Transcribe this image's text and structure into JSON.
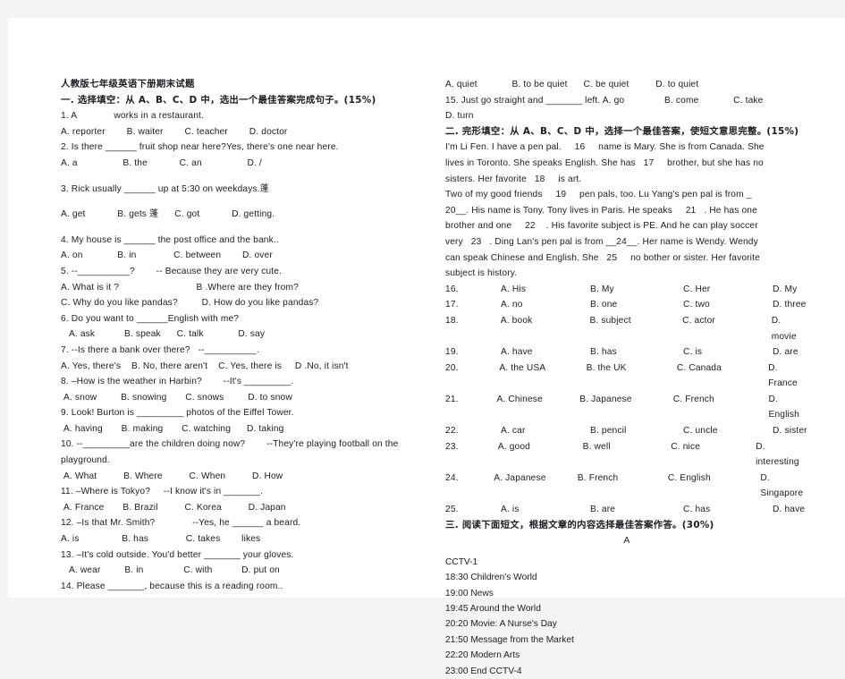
{
  "document": {
    "title": "人教版七年级英语下册期末试题"
  },
  "section_one": {
    "heading": "一. 选择填空：从 A、B、C、D 中，选出一个最佳答案完成句子。(15%)",
    "questions": [
      {
        "stem": "1. A              works in a restaurant.",
        "options": "A. reporter        B. waiter        C. teacher        D. doctor"
      },
      {
        "stem": "2. Is there ______ fruit shop near here?Yes, there's one near here.",
        "options": "A. a                 B. the            C. an                 D. /"
      },
      {
        "stem": "3. Rick usually ______ up at 5:30 on weekdays.蓬",
        "options": "A. get            B. gets 蓬      C. got            D. getting."
      },
      {
        "stem": "4. My house is ______ the post office and the bank..",
        "options": "A. on             B. in              C. between        D. over"
      },
      {
        "stem": "5. --__________?        -- Because they are very cute.",
        "options": "A. What is it ?                             B .Where are they from?",
        "options2": "C. Why do you like pandas?         D. How do you like pandas?"
      },
      {
        "stem": "6. Do you want to ______English with me?",
        "options": "   A. ask           B. speak      C. talk             D. say"
      },
      {
        "stem": "7. --Is there a bank over there?   --__________.",
        "options": "A. Yes, there's    B. No, there aren't    C. Yes, there is     D .No, it isn't"
      },
      {
        "stem": "8. –How is the weather in Harbin?        --It's _________.",
        "options": " A. snow         B. snowing       C. snows         D. to snow"
      },
      {
        "stem": "9. Look! Burton is _________ photos of the Eiffel Tower.",
        "options": " A. having       B. making       C. watching      D. taking"
      },
      {
        "stem": "10. --_________are the children doing now?        --They're playing football on the",
        "stem2": "playground.",
        "options": " A. What          B. Where          C. When          D. How"
      },
      {
        "stem": "11. –Where is Tokyo?     --I know it's in _______.",
        "options": " A. France       B. Brazil          C. Korea          D. Japan"
      },
      {
        "stem": "12. –Is that Mr. Smith?              --Yes, he ______ a beard.",
        "options": "A. is                B. has              C. takes        likes"
      },
      {
        "stem": "13. –It's cold outside. You'd better _______ your gloves.",
        "options": "   A. wear         B. in               C. with           D. put on"
      },
      {
        "stem": "14. Please _______, because this is a reading room..",
        "options": "A. quiet             B. to be quiet      C. be quiet          D. to quiet"
      },
      {
        "stem": "15. Just go straight and _______ left. A. go               B. come             C. take",
        "options": "D. turn"
      }
    ]
  },
  "section_two": {
    "heading": "二. 完形填空：从 A、B、C、D 中，选择一个最佳答案，使短文意思完整。(15%)",
    "passage": [
      "I'm Li Fen. I have a pen pal.     16     name is Mary. She is from Canada. She",
      "lives in Toronto. She speaks English. She has   17     brother, but she has no",
      "sisters. Her favorite   18     is art.",
      "Two of my good friends     19     pen pals, too. Lu Yang's pen pal is from _",
      "20__. His name is Tony. Tony lives in Paris. He speaks     21   . He has one",
      "brother and one     22    . His favorite subject is PE. And he can play soccer",
      "very   23   . Ding Lan's pen pal is from __24__. Her name is Wendy. Wendy",
      "can speak Chinese and English. She   25     no bother or sister. Her favorite",
      "subject is history."
    ],
    "options": [
      {
        "num": "16.",
        "a": "A. His",
        "b": "B. My",
        "c": "C. Her",
        "d": "D. My"
      },
      {
        "num": "17.",
        "a": "A. no",
        "b": "B. one",
        "c": "C. two",
        "d": "D. three"
      },
      {
        "num": "18.",
        "a": "A. book",
        "b": "B. subject",
        "c": "C. actor",
        "d": "D. movie"
      },
      {
        "num": "19.",
        "a": "A. have",
        "b": "B. has",
        "c": "C. is",
        "d": "D. are"
      },
      {
        "num": "20.",
        "a": "A. the USA",
        "b": "B. the UK",
        "c": "C. Canada",
        "d": "D. France"
      },
      {
        "num": "21.",
        "a": "A. Chinese",
        "b": "B. Japanese",
        "c": "C. French",
        "d": "D. English"
      },
      {
        "num": "22.",
        "a": "A. car",
        "b": "B. pencil",
        "c": "C. uncle",
        "d": "D. sister"
      },
      {
        "num": "23.",
        "a": "A. good",
        "b": "B. well",
        "c": "C. nice",
        "d": "D. interesting"
      },
      {
        "num": "24.",
        "a": "A. Japanese",
        "b": "B. French",
        "c": "C. English",
        "d": "D. Singapore"
      },
      {
        "num": "25.",
        "a": "A. is",
        "b": "B. are",
        "c": "C. has",
        "d": "D. have"
      }
    ]
  },
  "section_three": {
    "heading": "三. 阅读下面短文，根据文章的内容选择最佳答案作答。(30%)",
    "passage_label": "A",
    "tv_channel": "CCTV-1",
    "tv_schedule": [
      "18:30 Children's World",
      "19:00 News",
      "19:45 Around the World",
      "20:20 Movie: A Nurse's Day",
      "21:50 Message from the Market",
      "22:20 Modern Arts",
      "23:00 End CCTV-4"
    ]
  }
}
